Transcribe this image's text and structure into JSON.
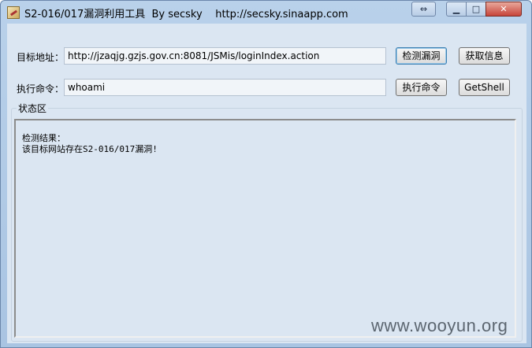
{
  "window": {
    "title": "S2-016/017漏洞利用工具  By secsky    http://secsky.sinaapp.com"
  },
  "form": {
    "target_label": "目标地址：",
    "target_value": "http://jzaqjg.gzjs.gov.cn:8081/JSMis/loginIndex.action",
    "command_label": "执行命令：",
    "command_value": "whoami",
    "check_button": "检测漏洞",
    "getinfo_button": "获取信息",
    "exec_button": "执行命令",
    "getshell_button": "GetShell"
  },
  "status": {
    "group_label": "状态区",
    "line1": "检测结果：",
    "line2": "该目标网站存在S2-016/017漏洞!"
  },
  "watermark": "www.wooyun.org"
}
